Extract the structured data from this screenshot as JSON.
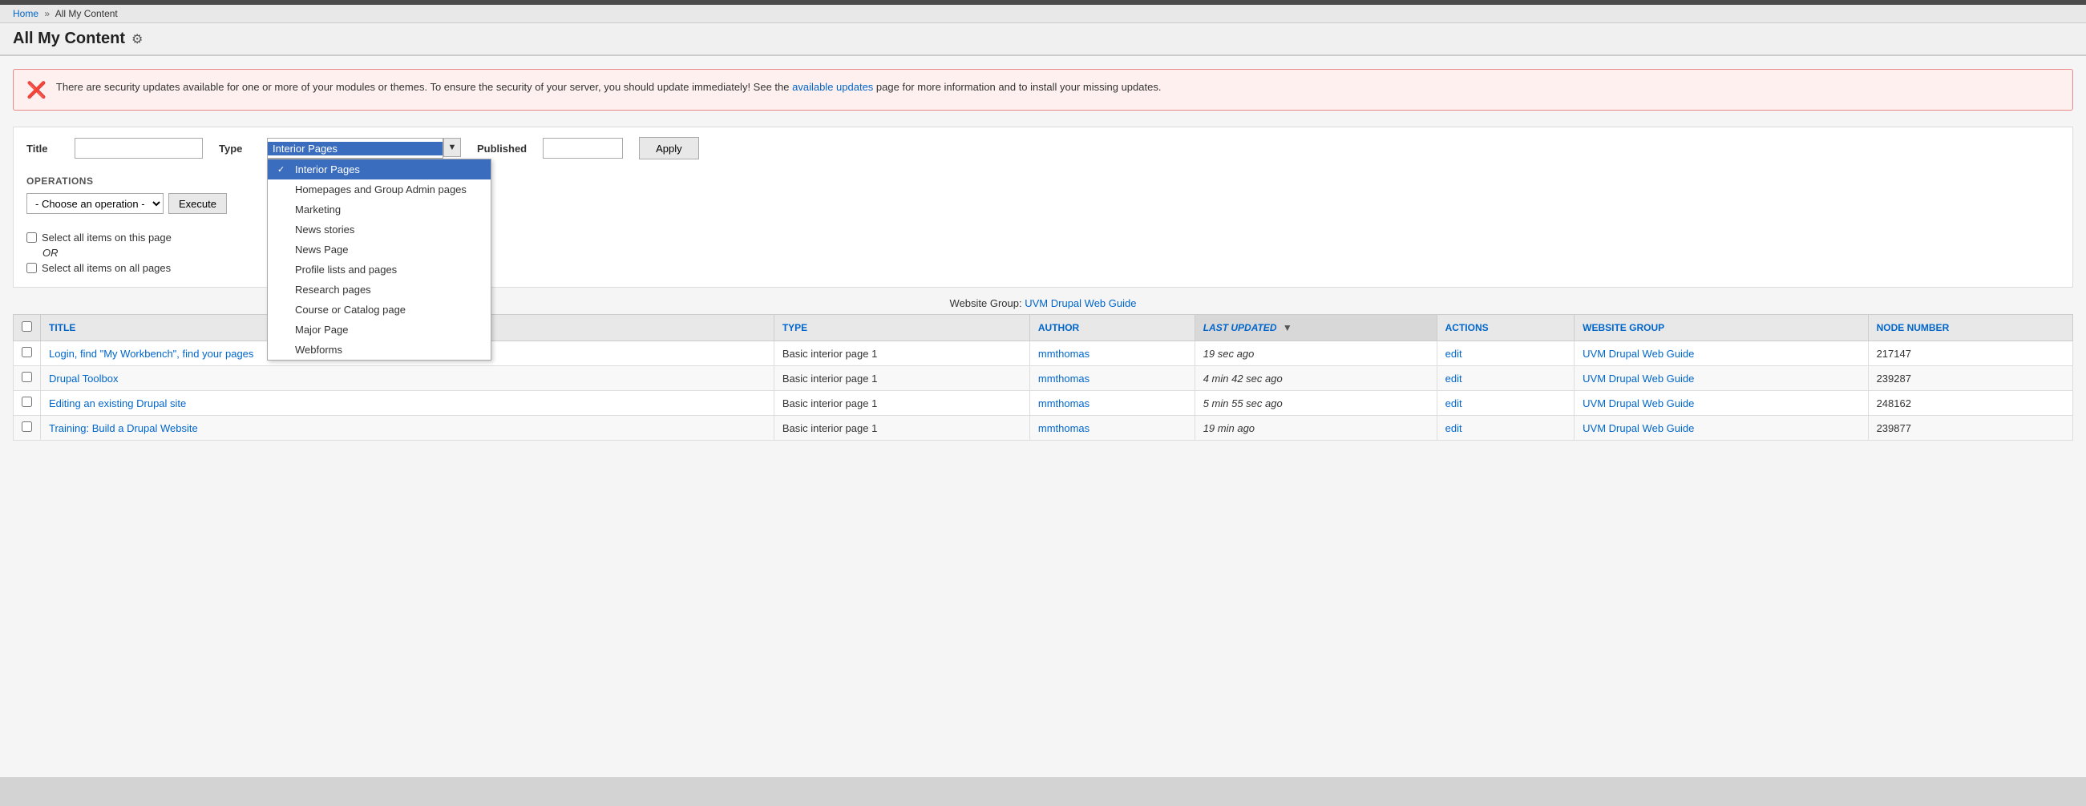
{
  "breadcrumb": {
    "home": "Home",
    "separator": "»",
    "current": "All My Content"
  },
  "page": {
    "title": "All My Content",
    "settings_icon": "⚙"
  },
  "alert": {
    "message_start": "There are security updates available for one or more of your modules or themes. To ensure the security of your server, you should update immediately! See the ",
    "link_text": "available updates",
    "message_end": " page for more information and to install your missing updates."
  },
  "filters": {
    "title_label": "Title",
    "type_label": "Type",
    "published_label": "Published",
    "apply_label": "Apply",
    "title_placeholder": "",
    "published_placeholder": ""
  },
  "type_dropdown": {
    "selected": "Interior Pages",
    "options": [
      {
        "label": "Interior Pages",
        "selected": true
      },
      {
        "label": "Homepages and Group Admin pages",
        "selected": false
      },
      {
        "label": "Marketing",
        "selected": false
      },
      {
        "label": "News stories",
        "selected": false
      },
      {
        "label": "News Page",
        "selected": false
      },
      {
        "label": "Profile lists and pages",
        "selected": false
      },
      {
        "label": "Research pages",
        "selected": false
      },
      {
        "label": "Course or Catalog page",
        "selected": false
      },
      {
        "label": "Major Page",
        "selected": false
      },
      {
        "label": "Webforms",
        "selected": false
      }
    ]
  },
  "operations": {
    "label": "OPERATIONS",
    "placeholder": "- Choose an operation -",
    "options": [
      "- Choose an operation -"
    ]
  },
  "select_all": {
    "this_page_label": "Select all items on this page",
    "all_pages_label": "Select all items on all pages",
    "or_text": "OR"
  },
  "table": {
    "website_group_label": "Website Group:",
    "website_group_link": "UVM Drupal Web Guide",
    "columns": {
      "title": "TITLE",
      "type": "TYPE",
      "author": "AUTHOR",
      "last_updated": "LAST UPDATED",
      "actions": "ACTIONS",
      "website_group": "WEBSITE GROUP",
      "node_number": "NODE NUMBER"
    },
    "rows": [
      {
        "title": "Login, find \"My Workbench\", find your pages",
        "type": "Basic interior page 1",
        "author": "mmthomas",
        "last_updated": "19 sec ago",
        "actions": "edit",
        "website_group": "UVM Drupal Web Guide",
        "node_number": "217147"
      },
      {
        "title": "Drupal Toolbox",
        "type": "Basic interior page 1",
        "author": "mmthomas",
        "last_updated": "4 min 42 sec ago",
        "actions": "edit",
        "website_group": "UVM Drupal Web Guide",
        "node_number": "239287"
      },
      {
        "title": "Editing an existing Drupal site",
        "type": "Basic interior page 1",
        "author": "mmthomas",
        "last_updated": "5 min 55 sec ago",
        "actions": "edit",
        "website_group": "UVM Drupal Web Guide",
        "node_number": "248162"
      },
      {
        "title": "Training: Build a Drupal Website",
        "type": "Basic interior page 1",
        "author": "mmthomas",
        "last_updated": "19 min ago",
        "actions": "edit",
        "website_group": "UVM Drupal Web Guide",
        "node_number": "239877"
      }
    ]
  }
}
